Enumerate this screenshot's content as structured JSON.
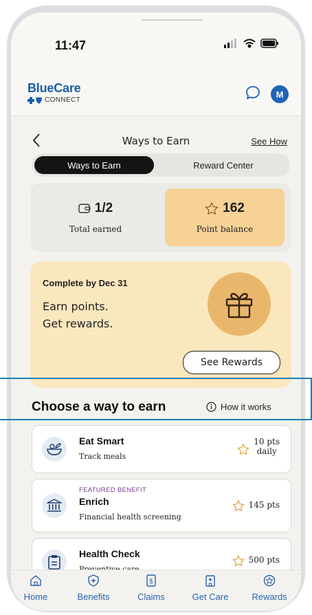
{
  "status": {
    "time": "11:47"
  },
  "brand": {
    "name": "BlueCare",
    "sub": "CONNECT",
    "avatar_initial": "M"
  },
  "nav": {
    "title": "Ways to Earn",
    "link": "See How"
  },
  "segments": {
    "active": "Ways to Earn",
    "inactive": "Reward Center"
  },
  "stats": {
    "earned_value": "1/2",
    "earned_label": "Total earned",
    "points_value": "162",
    "points_label": "Point balance"
  },
  "promo": {
    "due": "Complete by Dec 31",
    "line1": "Earn points.",
    "line2": "Get rewards.",
    "button": "See Rewards"
  },
  "section": {
    "title": "Choose a way to earn",
    "help": "How it works"
  },
  "cards": [
    {
      "title": "Eat Smart",
      "subtitle": "Track meals",
      "points": "10 pts",
      "points_freq": "daily",
      "featured": ""
    },
    {
      "title": "Enrich",
      "subtitle": "Financial health screening",
      "points": "145 pts",
      "points_freq": "",
      "featured": "FEATURED BENEFIT"
    },
    {
      "title": "Health Check",
      "subtitle": "Preventive care",
      "points": "500 pts",
      "points_freq": "",
      "featured": ""
    }
  ],
  "tabs": [
    "Home",
    "Benefits",
    "Claims",
    "Get Care",
    "Rewards"
  ],
  "colors": {
    "accent": "#1f64b8",
    "tab_text": "#2a63b0",
    "points_bg": "#f6d296",
    "promo_bg": "#fbe7be",
    "highlight": "#1f7fb0"
  },
  "icons": [
    "signal-icon",
    "wifi-icon",
    "battery-icon",
    "chat-icon",
    "back-icon",
    "wallet-icon",
    "star-icon",
    "gift-icon",
    "info-icon",
    "salad-icon",
    "bank-icon",
    "clipboard-icon",
    "home-icon",
    "shield-plus-icon",
    "dollar-doc-icon",
    "building-icon",
    "rewards-icon"
  ]
}
